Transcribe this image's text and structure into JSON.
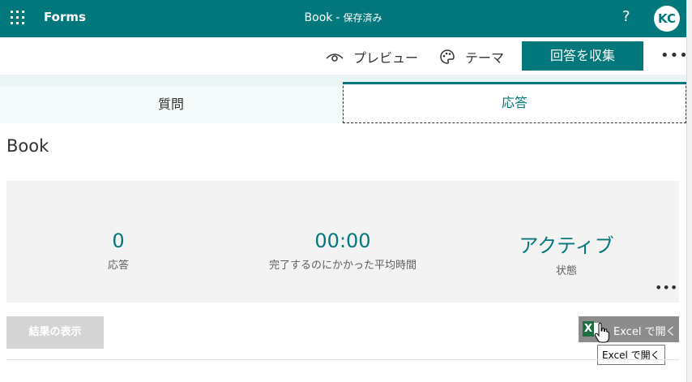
{
  "app": {
    "name": "Forms"
  },
  "header": {
    "title": "Book",
    "separator": "-",
    "status": "保存済み",
    "help": "?",
    "avatar": "KC"
  },
  "toolbar": {
    "preview": "プレビュー",
    "theme": "テーマ",
    "collect": "回答を収集",
    "more": "•••"
  },
  "tabs": {
    "questions": "質問",
    "responses": "応答"
  },
  "form": {
    "title": "Book"
  },
  "summary": {
    "responses": {
      "value": "0",
      "label": "応答"
    },
    "avg_time": {
      "value": "00:00",
      "label": "完了するのにかかった平均時間"
    },
    "status": {
      "value": "アクティブ",
      "label": "状態"
    },
    "more": "•••"
  },
  "actions": {
    "view_results": "結果の表示",
    "open_excel": "Excel で開く",
    "excel_icon": "X"
  },
  "tooltip": {
    "text": "Excel で開く"
  },
  "colors": {
    "accent": "#03787c"
  },
  "icons": [
    "waffle-icon",
    "eye-icon",
    "palette-icon",
    "excel-icon",
    "hand-cursor-icon"
  ]
}
